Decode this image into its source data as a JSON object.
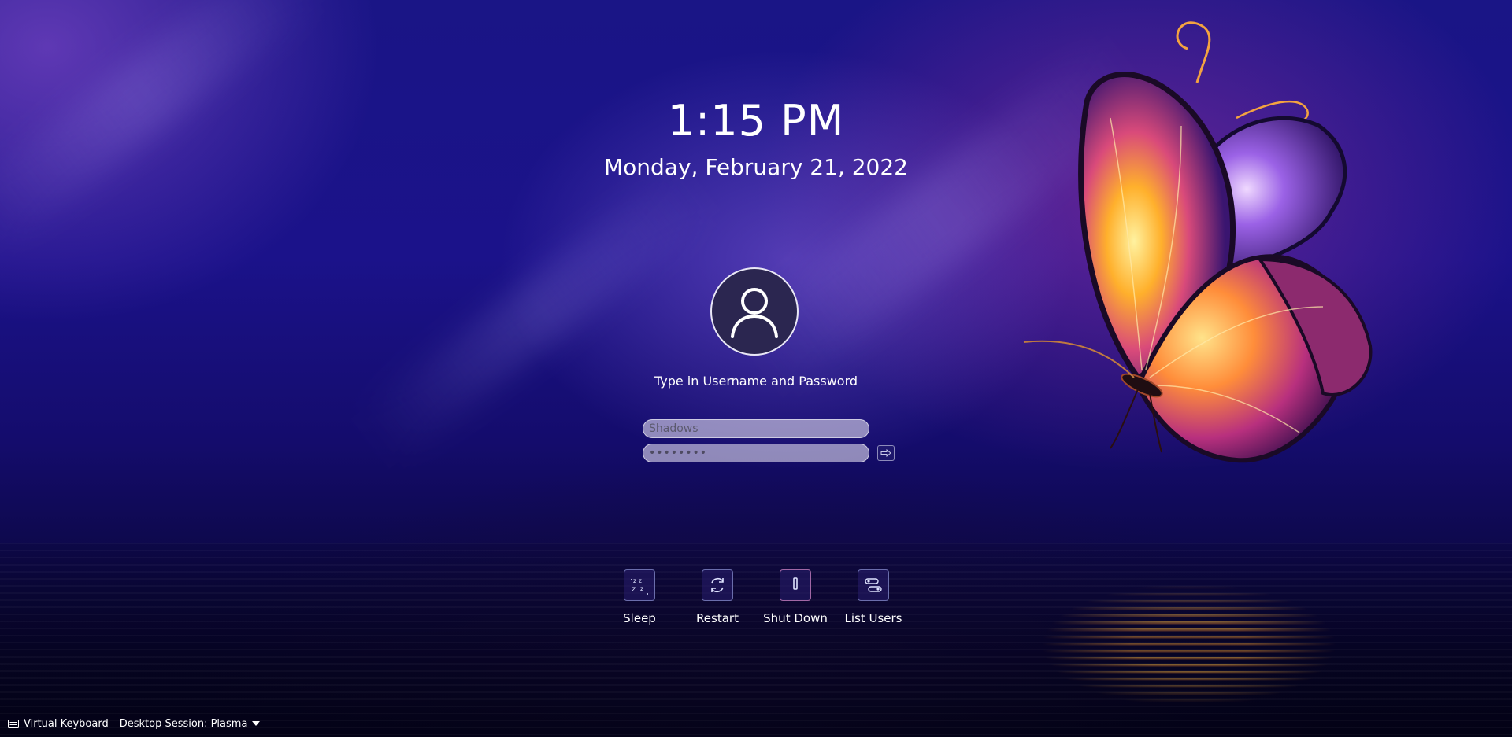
{
  "clock": {
    "time": "1:15 PM",
    "date": "Monday, February 21, 2022"
  },
  "login": {
    "avatar_icon": "user-icon",
    "prompt": "Type in Username and Password",
    "username_value": "Shadows",
    "password_value": "••••••••",
    "login_icon": "arrow-right-icon"
  },
  "actions": [
    {
      "label": "Sleep",
      "icon": "sleep-icon"
    },
    {
      "label": "Restart",
      "icon": "restart-icon"
    },
    {
      "label": "Shut Down",
      "icon": "power-icon"
    },
    {
      "label": "List Users",
      "icon": "list-users-icon"
    }
  ],
  "bottom_bar": {
    "keyboard_label": "Virtual Keyboard",
    "session_label": "Desktop Session: Plasma"
  },
  "colors": {
    "background_top": "#1a1586",
    "background_bottom": "#05031e",
    "avatar_bg": "#2b2650",
    "accent_butterfly": "#ffb030"
  }
}
